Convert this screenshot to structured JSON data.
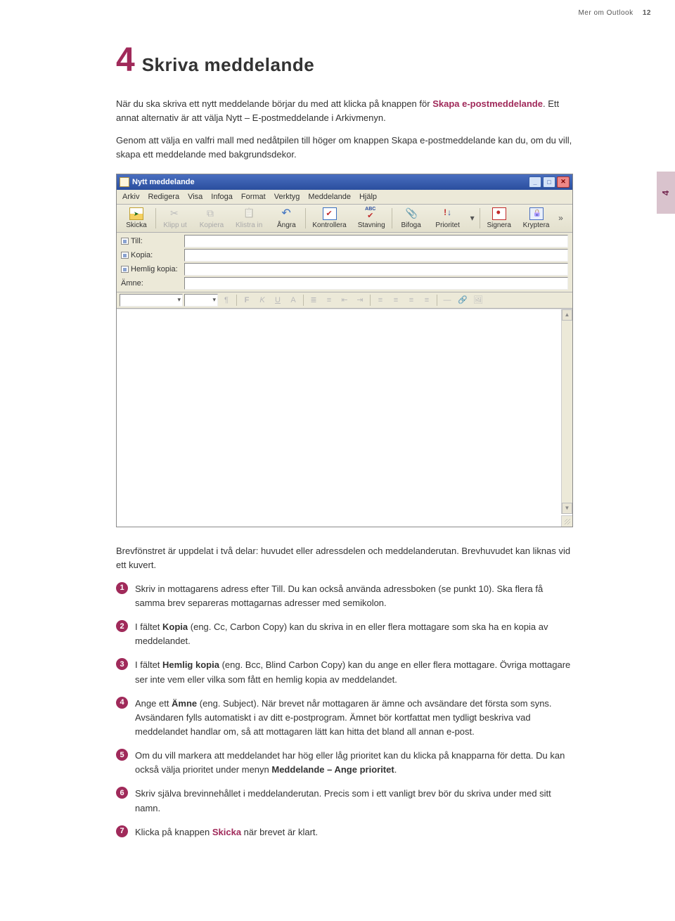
{
  "header": {
    "section": "Mer om Outlook",
    "page": "12"
  },
  "side_tab": "4",
  "chapter": {
    "number": "4",
    "title": "Skriva meddelande"
  },
  "p1a": "När du ska skriva ett nytt meddelande börjar du med att klicka på knappen för ",
  "p1b": "Skapa e-postmeddelande",
  "p1c": ". Ett annat alternativ är att välja Nytt – E-postmeddelande i Arkivmenyn.",
  "p2": "Genom att välja en valfri mall med nedåtpilen till höger om knappen Skapa e-postmeddelande kan du, om du vill, skapa ett meddelande med bakgrundsdekor.",
  "app": {
    "title": "Nytt meddelande",
    "menu": [
      "Arkiv",
      "Redigera",
      "Visa",
      "Infoga",
      "Format",
      "Verktyg",
      "Meddelande",
      "Hjälp"
    ],
    "toolbar": {
      "send": "Skicka",
      "cut": "Klipp ut",
      "copy": "Kopiera",
      "paste": "Klistra in",
      "undo": "Ångra",
      "check": "Kontrollera",
      "spell": "Stavning",
      "attach": "Bifoga",
      "prio": "Prioritet",
      "sign": "Signera",
      "crypt": "Kryptera"
    },
    "fields": {
      "to": "Till:",
      "cc": "Kopia:",
      "bcc": "Hemlig kopia:",
      "subject": "Ämne:"
    }
  },
  "after1": "Brevfönstret är uppdelat i två delar: huvudet eller adressdelen och meddelanderutan. Brevhuvudet kan liknas vid ett kuvert.",
  "list": [
    {
      "n": "1",
      "t": "Skriv in mottagarens adress efter Till. Du kan också använda adressboken (se punkt 10). Ska flera få samma brev separeras mottagarnas adresser med semikolon."
    },
    {
      "n": "2",
      "pre": "I fältet ",
      "b": "Kopia",
      "post": " (eng. Cc, Carbon Copy) kan du skriva in en eller flera mottagare som ska ha en kopia av meddelandet."
    },
    {
      "n": "3",
      "pre": "I fältet ",
      "b": "Hemlig kopia",
      "post": " (eng. Bcc, Blind Carbon Copy) kan du ange en eller flera mottagare. Övriga mottagare ser inte vem eller vilka som fått en hemlig kopia av meddelandet."
    },
    {
      "n": "4",
      "pre": "Ange ett ",
      "b": "Ämne",
      "post": " (eng. Subject). När brevet når mottagaren är ämne och avsändare det första som syns. Avsändaren fylls automatiskt i av ditt e-postprogram. Ämnet bör kortfattat men tydligt beskriva vad meddelandet handlar om, så att mottagaren lätt kan hitta det bland all annan e-post."
    },
    {
      "n": "5",
      "pre": "Om du vill markera att meddelandet har hög eller låg prioritet kan du klicka på knapparna för detta. Du kan också välja prioritet under menyn ",
      "b": "Meddelande – Ange prioritet",
      "post": "."
    },
    {
      "n": "6",
      "t": "Skriv själva brevinnehållet i meddelanderutan. Precis som i ett vanligt brev bör du skriva under med sitt namn."
    },
    {
      "n": "7",
      "pre": "Klicka på knappen ",
      "accent": "Skicka",
      "post": " när brevet är klart."
    }
  ]
}
